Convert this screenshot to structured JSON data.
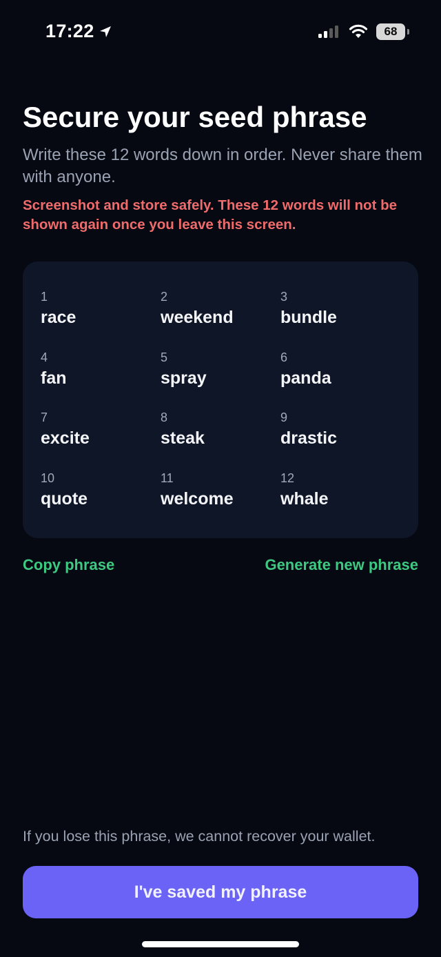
{
  "status_bar": {
    "time": "17:22",
    "battery": "68",
    "icons": [
      "location-arrow-icon",
      "cellular-signal-icon",
      "wifi-icon",
      "battery-icon"
    ]
  },
  "header": {
    "title": "Secure your seed phrase",
    "subtitle": "Write these 12 words down in order. Never share them with anyone.",
    "warning": "Screenshot and store safely. These 12 words will not be shown again once you leave this screen."
  },
  "seed_words": [
    {
      "number": "1",
      "word": "race"
    },
    {
      "number": "2",
      "word": "weekend"
    },
    {
      "number": "3",
      "word": "bundle"
    },
    {
      "number": "4",
      "word": "fan"
    },
    {
      "number": "5",
      "word": "spray"
    },
    {
      "number": "6",
      "word": "panda"
    },
    {
      "number": "7",
      "word": "excite"
    },
    {
      "number": "8",
      "word": "steak"
    },
    {
      "number": "9",
      "word": "drastic"
    },
    {
      "number": "10",
      "word": "quote"
    },
    {
      "number": "11",
      "word": "welcome"
    },
    {
      "number": "12",
      "word": "whale"
    }
  ],
  "actions": {
    "copy_label": "Copy phrase",
    "generate_label": "Generate new phrase"
  },
  "footer": {
    "note": "If you lose this phrase, we cannot recover your wallet.",
    "button_label": "I've saved my phrase"
  },
  "colors": {
    "background": "#060912",
    "card": "#0f1627",
    "warning": "#f06b6b",
    "link": "#3ec983",
    "primary": "#6b63f6"
  }
}
